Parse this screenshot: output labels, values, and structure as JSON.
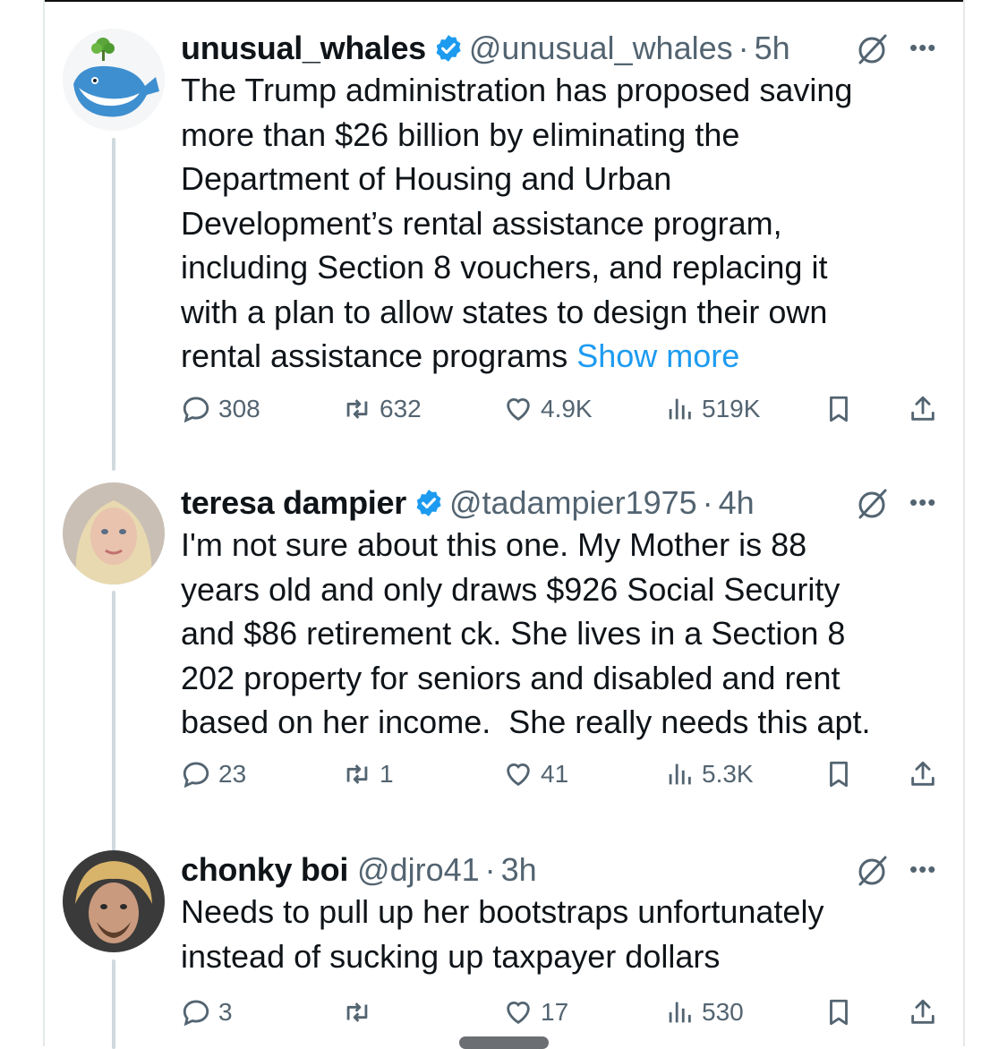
{
  "colors": {
    "accent": "#1d9bf0",
    "text": "#0f1419",
    "muted": "#536471",
    "thread_line": "#cfd9de"
  },
  "tweets": [
    {
      "name": "unusual_whales",
      "verified": true,
      "handle": "@unusual_whales",
      "time": "5h",
      "text": "The Trump administration has proposed saving\nmore than $26 billion by eliminating the\nDepartment of Housing and Urban\nDevelopment’s rental assistance program,\nincluding Section 8 vouchers, and replacing it\nwith a plan to allow states to design their own\nrental assistance programs ",
      "show_more": "Show more",
      "stats": {
        "replies": "308",
        "reposts": "632",
        "likes": "4.9K",
        "views": "519K"
      },
      "avatar_icon": "whale-logo-icon"
    },
    {
      "name": "teresa dampier",
      "verified": true,
      "handle": "@tadampier1975",
      "time": "4h",
      "text": "I'm not sure about this one. My Mother is 88\nyears old and only draws $926 Social Security\nand $86 retirement ck. She lives in a Section 8\n202 property for seniors and disabled and rent\nbased on her income.  She really needs this apt.",
      "stats": {
        "replies": "23",
        "reposts": "1",
        "likes": "41",
        "views": "5.3K"
      },
      "avatar_icon": "profile-photo"
    },
    {
      "name": "chonky boi",
      "verified": false,
      "handle": "@djro41",
      "time": "3h",
      "text": "Needs to pull up her bootstraps unfortunately\ninstead of sucking up taxpayer dollars",
      "stats": {
        "replies": "3",
        "reposts": "",
        "likes": "17",
        "views": "530"
      },
      "avatar_icon": "profile-photo"
    }
  ],
  "icons": {
    "reply": "reply-icon",
    "repost": "repost-icon",
    "like": "heart-icon",
    "views": "views-icon",
    "bookmark": "bookmark-icon",
    "share": "share-icon",
    "grok": "grok-icon",
    "more": "more-icon",
    "verified": "verified-badge-icon"
  }
}
